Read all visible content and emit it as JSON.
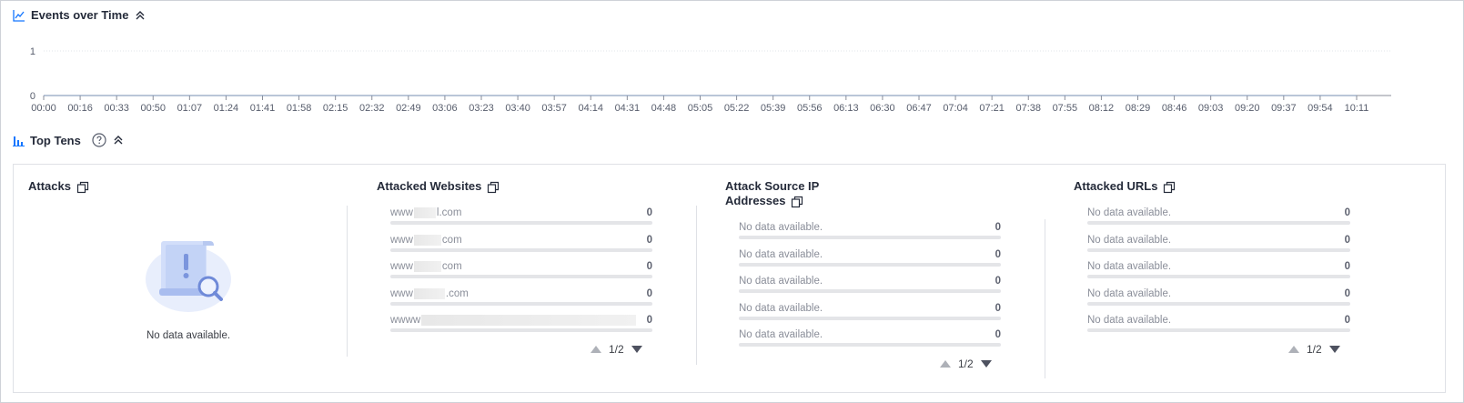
{
  "events": {
    "title": "Events over Time",
    "chart_data": {
      "type": "line",
      "x": [
        "00:00",
        "00:16",
        "00:33",
        "00:50",
        "01:07",
        "01:24",
        "01:41",
        "01:58",
        "02:15",
        "02:32",
        "02:49",
        "03:06",
        "03:23",
        "03:40",
        "03:57",
        "04:14",
        "04:31",
        "04:48",
        "05:05",
        "05:22",
        "05:39",
        "05:56",
        "06:13",
        "06:30",
        "06:47",
        "07:04",
        "07:21",
        "07:38",
        "07:55",
        "08:12",
        "08:29",
        "08:46",
        "09:03",
        "09:20",
        "09:37",
        "09:54",
        "10:11"
      ],
      "series": [
        {
          "values": [
            0,
            0,
            0,
            0,
            0,
            0,
            0,
            0,
            0,
            0,
            0,
            0,
            0,
            0,
            0,
            0,
            0,
            0,
            0,
            0,
            0,
            0,
            0,
            0,
            0,
            0,
            0,
            0,
            0,
            0,
            0,
            0,
            0,
            0,
            0,
            0,
            0
          ]
        }
      ],
      "ylim": [
        0,
        1
      ],
      "yticks": [
        "0",
        "1"
      ],
      "grid": true,
      "line_color": "#3d8eff",
      "axis_color": "#8a8e99"
    }
  },
  "top_tens": {
    "title": "Top Tens",
    "accent": "#1476ff",
    "attacks": {
      "title": "Attacks",
      "empty_text": "No data available."
    },
    "websites": {
      "title": "Attacked Websites",
      "rows": [
        {
          "pre": "www",
          "post": "l.com",
          "value": "0"
        },
        {
          "pre": "www",
          "post": "com",
          "value": "0"
        },
        {
          "pre": "www",
          "post": "com",
          "value": "0"
        },
        {
          "pre": "www",
          "post": ".com",
          "value": "0"
        },
        {
          "pre": "wwww",
          "post": "",
          "value": "0"
        }
      ],
      "pager": "1/2"
    },
    "source_ips": {
      "title_line1": "Attack Source IP",
      "title_line2": "Addresses",
      "rows": [
        {
          "label": "No data available.",
          "value": "0"
        },
        {
          "label": "No data available.",
          "value": "0"
        },
        {
          "label": "No data available.",
          "value": "0"
        },
        {
          "label": "No data available.",
          "value": "0"
        },
        {
          "label": "No data available.",
          "value": "0"
        }
      ],
      "pager": "1/2"
    },
    "urls": {
      "title": "Attacked URLs",
      "rows": [
        {
          "label": "No data available.",
          "value": "0"
        },
        {
          "label": "No data available.",
          "value": "0"
        },
        {
          "label": "No data available.",
          "value": "0"
        },
        {
          "label": "No data available.",
          "value": "0"
        },
        {
          "label": "No data available.",
          "value": "0"
        }
      ],
      "pager": "1/2"
    }
  }
}
